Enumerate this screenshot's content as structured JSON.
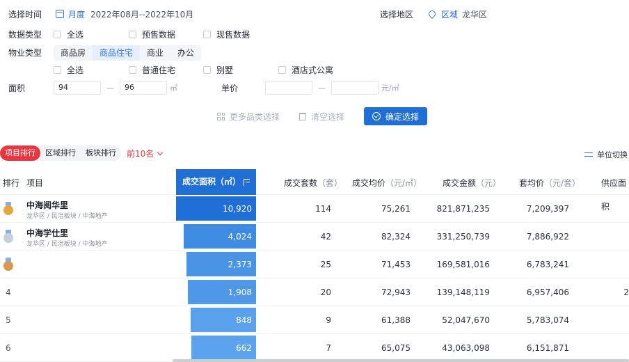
{
  "filters": {
    "time": {
      "label": "选择时间",
      "mode": "月度",
      "range": "2022年08月--2022年10月"
    },
    "region": {
      "label": "选择地区",
      "type": "区域",
      "value": "龙华区"
    },
    "data_type": {
      "label": "数据类型",
      "options": [
        "全选",
        "预售数据",
        "现售数据"
      ]
    },
    "property_type": {
      "label": "物业类型",
      "tabs": [
        "商品房",
        "商品住宅",
        "商业",
        "办公"
      ],
      "active_tab": "商品住宅",
      "options": [
        "全选",
        "普通住宅",
        "别墅",
        "酒店式公寓"
      ]
    },
    "area": {
      "label": "面积",
      "min": "94",
      "max": "96",
      "unit": "㎡",
      "separator": "—"
    },
    "price": {
      "label": "单价",
      "min": "",
      "max": "",
      "unit": "元/㎡",
      "separator": "—"
    },
    "actions": {
      "more": "更多品类选择",
      "clear": "清空选择",
      "confirm": "确定选择"
    }
  },
  "ranking": {
    "tabs": [
      "项目排行",
      "区域排行",
      "板块排行"
    ],
    "active_tab": "项目排行",
    "top_n": "前10名",
    "unit_switch": "单位切换",
    "columns": {
      "rank": "排行",
      "project": "项目",
      "area": "成交面积（㎡）",
      "units": "成交套数",
      "units_unit": "（套）",
      "avg_price": "成交均价",
      "avg_price_unit": "（元/㎡）",
      "amount": "成交金额",
      "amount_unit": "（元）",
      "unit_price": "套均价",
      "unit_price_unit": "（元/套）",
      "supply": "供应面积"
    },
    "rows": [
      {
        "rank": "1",
        "medal": "gold",
        "name": "中海阅华里",
        "meta": "龙华区 / 民治板块 / 中海地产",
        "area": "10,920",
        "area_value": 10920,
        "units": "114",
        "avg_price": "75,261",
        "amount": "821,871,235",
        "unit_price": "7,209,397",
        "supply": ""
      },
      {
        "rank": "2",
        "medal": "silver",
        "name": "中海学仕里",
        "meta": "龙华区 / 民治板块 / 中海地产",
        "area": "4,024",
        "area_value": 4024,
        "units": "42",
        "avg_price": "82,324",
        "amount": "331,250,739",
        "unit_price": "7,886,922",
        "supply": ""
      },
      {
        "rank": "3",
        "medal": "bronze",
        "name": "",
        "meta": "",
        "area": "2,373",
        "area_value": 2373,
        "units": "25",
        "avg_price": "71,453",
        "amount": "169,581,016",
        "unit_price": "6,783,241",
        "supply": ""
      },
      {
        "rank": "4",
        "medal": "",
        "name": "",
        "meta": "",
        "area": "1,908",
        "area_value": 1908,
        "units": "20",
        "avg_price": "72,943",
        "amount": "139,148,119",
        "unit_price": "6,957,406",
        "supply": "2"
      },
      {
        "rank": "5",
        "medal": "",
        "name": "",
        "meta": "",
        "area": "848",
        "area_value": 848,
        "units": "9",
        "avg_price": "61,388",
        "amount": "52,047,670",
        "unit_price": "5,783,074",
        "supply": ""
      },
      {
        "rank": "6",
        "medal": "",
        "name": "",
        "meta": "",
        "area": "662",
        "area_value": 662,
        "units": "7",
        "avg_price": "65,075",
        "amount": "43,063,098",
        "unit_price": "6,151,871",
        "supply": ""
      }
    ]
  },
  "colors": {
    "accent": "#1f6fd6",
    "rank_red": "#e8353f",
    "gold": "#e6a83a",
    "silver": "#c7cfdc",
    "bronze": "#d99a4e"
  }
}
